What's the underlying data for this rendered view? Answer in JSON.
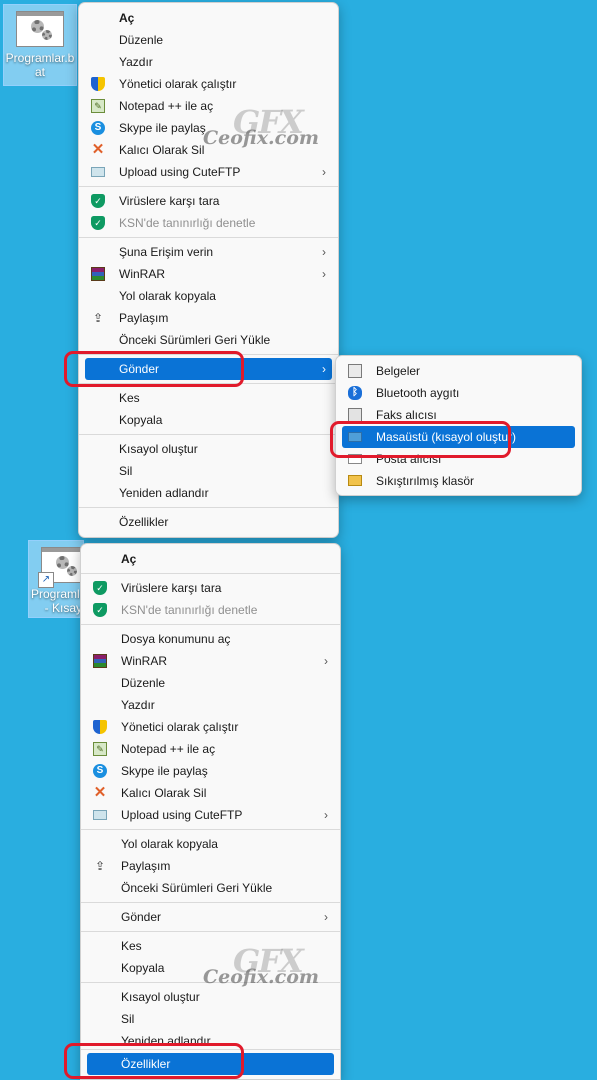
{
  "desktop": {
    "icon_top": {
      "label": "Programlar.bat"
    },
    "icon_bottom": {
      "label": "Programlar.bat - Kısayol"
    }
  },
  "menu1": {
    "items": [
      {
        "label": "Aç"
      },
      {
        "label": "Düzenle"
      },
      {
        "label": "Yazdır"
      },
      {
        "label": "Yönetici olarak çalıştır",
        "icon": "uac-shield-icon"
      },
      {
        "label": "Notepad ++ ile aç",
        "icon": "notepadpp-icon"
      },
      {
        "label": "Skype ile paylaş",
        "icon": "skype-icon"
      },
      {
        "label": "Kalıcı Olarak Sil",
        "icon": "delete-x-icon"
      },
      {
        "label": "Upload using CuteFTP",
        "icon": "cuteftp-icon"
      },
      {
        "label": "Virüslere karşı tara",
        "icon": "kaspersky-shield-icon"
      },
      {
        "label": "KSN'de tanınırlığı denetle",
        "icon": "kaspersky-shield-icon"
      },
      {
        "label": "Şuna Erişim verin"
      },
      {
        "label": "WinRAR",
        "icon": "winrar-icon"
      },
      {
        "label": "Yol olarak kopyala"
      },
      {
        "label": "Paylaşım",
        "icon": "share-icon"
      },
      {
        "label": "Önceki Sürümleri Geri Yükle"
      },
      {
        "label": "Gönder"
      },
      {
        "label": "Kes"
      },
      {
        "label": "Kopyala"
      },
      {
        "label": "Kısayol oluştur"
      },
      {
        "label": "Sil"
      },
      {
        "label": "Yeniden adlandır"
      },
      {
        "label": "Özellikler"
      }
    ]
  },
  "submenu": {
    "items": [
      {
        "label": "Belgeler",
        "icon": "documents-icon"
      },
      {
        "label": "Bluetooth aygıtı",
        "icon": "bluetooth-icon"
      },
      {
        "label": "Faks alıcısı",
        "icon": "fax-icon"
      },
      {
        "label": "Masaüstü (kısayol oluştur)",
        "icon": "desktop-icon"
      },
      {
        "label": "Posta alıcısı",
        "icon": "mail-icon"
      },
      {
        "label": "Sıkıştırılmış klasör",
        "icon": "zip-folder-icon"
      }
    ]
  },
  "menu2": {
    "items": [
      {
        "label": "Aç"
      },
      {
        "label": "Virüslere karşı tara"
      },
      {
        "label": "KSN'de tanınırlığı denetle"
      },
      {
        "label": "Dosya konumunu aç"
      },
      {
        "label": "WinRAR"
      },
      {
        "label": "Düzenle"
      },
      {
        "label": "Yazdır"
      },
      {
        "label": "Yönetici olarak çalıştır"
      },
      {
        "label": "Notepad ++ ile aç"
      },
      {
        "label": "Skype ile paylaş"
      },
      {
        "label": "Kalıcı Olarak Sil"
      },
      {
        "label": "Upload using CuteFTP"
      },
      {
        "label": "Yol olarak kopyala"
      },
      {
        "label": "Paylaşım"
      },
      {
        "label": "Önceki Sürümleri Geri Yükle"
      },
      {
        "label": "Gönder"
      },
      {
        "label": "Kes"
      },
      {
        "label": "Kopyala"
      },
      {
        "label": "Kısayol oluştur"
      },
      {
        "label": "Sil"
      },
      {
        "label": "Yeniden adlandır"
      },
      {
        "label": "Özellikler"
      }
    ]
  },
  "watermark": {
    "logo": "GFX",
    "text": "Ceofix.com"
  },
  "colors": {
    "desktop_bg": "#29aee0",
    "highlight": "#0a73d6",
    "annotation": "#e11a2b"
  }
}
